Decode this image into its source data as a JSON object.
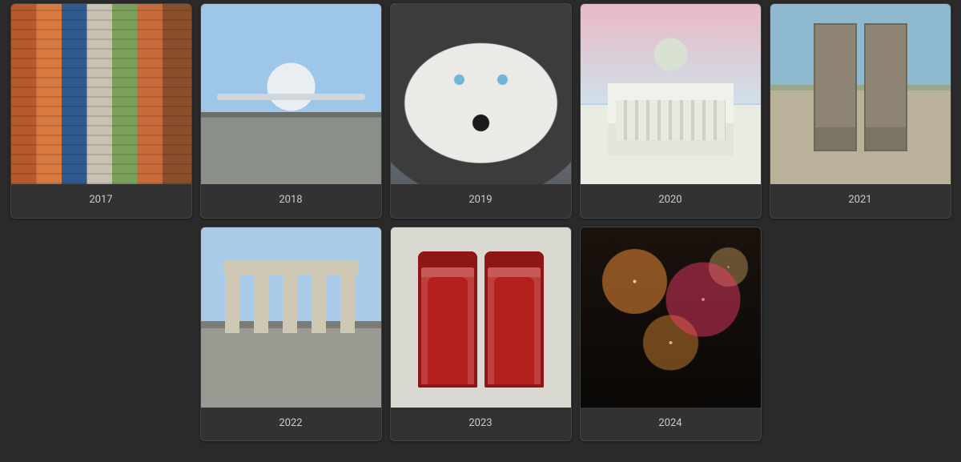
{
  "albums": [
    {
      "label": "2017",
      "thumb_class": "thumb-containers"
    },
    {
      "label": "2018",
      "thumb_class": "thumb-airplane"
    },
    {
      "label": "2019",
      "thumb_class": "thumb-husky"
    },
    {
      "label": "2020",
      "thumb_class": "thumb-cathedral"
    },
    {
      "label": "2021",
      "thumb_class": "thumb-gothic"
    },
    {
      "label": "2022",
      "thumb_class": "thumb-gate"
    },
    {
      "label": "2023",
      "thumb_class": "thumb-phonebox"
    },
    {
      "label": "2024",
      "thumb_class": "thumb-fireworks"
    }
  ]
}
